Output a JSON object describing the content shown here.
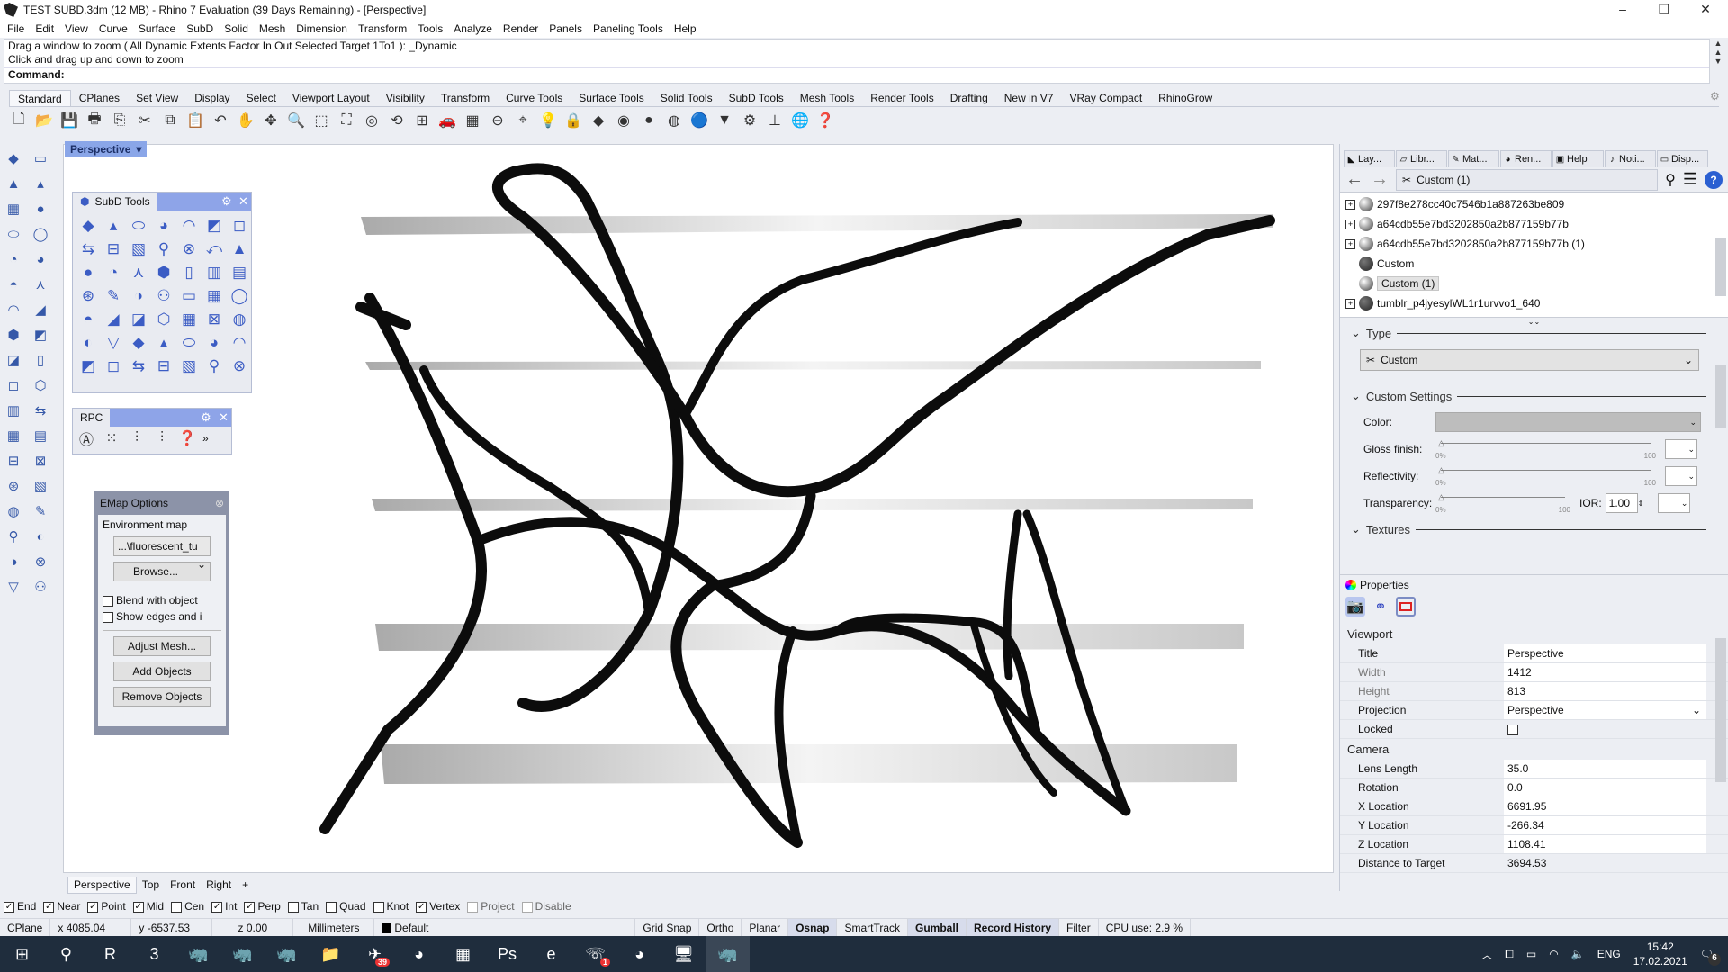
{
  "window": {
    "title": "TEST SUBD.3dm (12 MB) - Rhino 7 Evaluation (39 Days Remaining) - [Perspective]",
    "minimize": "–",
    "restore": "❐",
    "close": "✕"
  },
  "menu": [
    "File",
    "Edit",
    "View",
    "Curve",
    "Surface",
    "SubD",
    "Solid",
    "Mesh",
    "Dimension",
    "Transform",
    "Tools",
    "Analyze",
    "Render",
    "Panels",
    "Paneling Tools",
    "Help"
  ],
  "command": {
    "line1": "Drag a window to zoom ( All  Dynamic  Extents  Factor  In  Out  Selected  Target  1To1 ): _Dynamic",
    "line2": "Click and drag up and down to zoom",
    "prompt": "Command:"
  },
  "toolbar_tabs": [
    "Standard",
    "CPlanes",
    "Set View",
    "Display",
    "Select",
    "Viewport Layout",
    "Visibility",
    "Transform",
    "Curve Tools",
    "Surface Tools",
    "Solid Tools",
    "SubD Tools",
    "Mesh Tools",
    "Render Tools",
    "Drafting",
    "New in V7",
    "VRay Compact",
    "RhinoGrow"
  ],
  "toolbar_icons": [
    [
      "new-icon",
      "🗋"
    ],
    [
      "open-icon",
      "📂"
    ],
    [
      "save-icon",
      "💾"
    ],
    [
      "print-icon",
      "🖶"
    ],
    [
      "import-icon",
      "⎘"
    ],
    [
      "cut-icon",
      "✂"
    ],
    [
      "copy-icon",
      "⧉"
    ],
    [
      "paste-icon",
      "📋"
    ],
    [
      "undo-icon",
      "↶"
    ],
    [
      "pan-icon",
      "✋"
    ],
    [
      "rotate-view-icon",
      "✥"
    ],
    [
      "zoom-dynamic-icon",
      "🔍"
    ],
    [
      "zoom-window-icon",
      "⬚"
    ],
    [
      "zoom-extents-icon",
      "⛶"
    ],
    [
      "zoom-selected-icon",
      "◎"
    ],
    [
      "undo-view-icon",
      "⟲"
    ],
    [
      "four-viewports-icon",
      "⊞"
    ],
    [
      "car-icon",
      "🚗"
    ],
    [
      "grid-icon",
      "▦"
    ],
    [
      "snap-icon",
      "⊖"
    ],
    [
      "gumball-icon",
      "⌖"
    ],
    [
      "light-icon",
      "💡"
    ],
    [
      "lock-icon",
      "🔒"
    ],
    [
      "layer-icon",
      "◆"
    ],
    [
      "color-wheel-icon",
      "◉"
    ],
    [
      "shaded-icon",
      "●"
    ],
    [
      "rendered-icon",
      "◍"
    ],
    [
      "render-sphere-icon",
      "🔵"
    ],
    [
      "cone-icon",
      "▼"
    ],
    [
      "gear-settings-icon",
      "⚙"
    ],
    [
      "dimension-icon",
      "⊥"
    ],
    [
      "globe-icon",
      "🌐"
    ],
    [
      "help-icon",
      "❓"
    ]
  ],
  "viewport": {
    "active_label": "Perspective",
    "bottom_tabs": [
      "Perspective",
      "Top",
      "Front",
      "Right"
    ],
    "add_tab": "+"
  },
  "left_tools": [
    "select-arrow-icon",
    "point-icon",
    "polyline-icon",
    "curve-icon",
    "circle-icon",
    "arc-icon",
    "rectangle-icon",
    "polygon-icon",
    "ellipse-icon",
    "fillet-curve-icon",
    "surface-icon",
    "surface-tools-icon",
    "box-icon",
    "boolean-icon",
    "extrude-icon",
    "solid-tools-icon",
    "mesh-icon",
    "explode-icon",
    "sphere-icon",
    "light-icon",
    "join-icon",
    "trim-icon",
    "fillet-icon",
    "offset-icon",
    "text-icon",
    "dimension-icon",
    "array-icon",
    "transform-icon",
    "block-icon",
    "analyze-icon",
    "grid-array-icon",
    "gumball-icon",
    "paint-icon",
    "check-icon",
    "cube-icon",
    "render-icon"
  ],
  "subd_panel": {
    "title": "SubD Tools",
    "icons": [
      "subd-box-icon",
      "subd-plane-icon",
      "subd-cone-icon",
      "subd-truncated-cone-icon",
      "subd-cylinder-icon",
      "subd-sphere-icon",
      "subd-ellipsoid-icon",
      "subd-torus-icon",
      "subd-quadball-icon",
      "subd-sweep1-icon",
      "subd-sweep2-icon",
      "subd-loft-icon",
      "subd-skin-icon",
      "subd-extrude-icon",
      "subd-bevel-icon",
      "subd-box-mesh-icon",
      "subd-bridge-icon",
      "subd-insert-point-icon",
      "subd-crease-icon",
      "subd-cube-icon",
      "subd-polygon-icon",
      "subd-append-icon",
      "subd-bridge-edges-icon",
      "subd-grid-icon",
      "subd-insert-edge-icon",
      "subd-delete-icon",
      "subd-slide-icon",
      "subd-fill-icon",
      "subd-patch-icon",
      "subd-offset-icon",
      "subd-thicken-icon",
      "subd-mesh-icon",
      "subd-repair-icon",
      "subd-stitch-icon",
      "subd-weld-icon",
      "subd-match-icon",
      "subd-faces-icon",
      "subd-edge-strip-icon",
      "subd-loop-icon",
      "subd-strip-icon",
      "subd-paint-icon",
      "subd-select-loop-icon",
      "subd-vertex-icon",
      "subd-face-icon",
      "subd-points-icon",
      "subd-filter-off-icon",
      "subd-filter-icon",
      "subd-symmetry-icon",
      "subd-undo-icon"
    ]
  },
  "rpc_panel": {
    "title": "RPC",
    "icons": [
      "rpc-logo-icon",
      "rpc-scatter-icon",
      "rpc-settings-icon",
      "rpc-edit-icon",
      "rpc-help-icon"
    ],
    "more": "»"
  },
  "emap": {
    "title": "EMap Options",
    "group": "Environment map",
    "map_value": "...\\fluorescent_tu",
    "browse": "Browse...",
    "blend": "Blend with object",
    "show_edges": "Show edges and i",
    "adjust": "Adjust Mesh...",
    "add": "Add Objects",
    "remove": "Remove Objects"
  },
  "right_panel": {
    "tabs": [
      "Lay...",
      "Libr...",
      "Mat...",
      "Ren...",
      "Help",
      "Noti...",
      "Disp..."
    ],
    "breadcrumb": "Custom (1)",
    "materials": [
      {
        "name": "297f8e278cc40c7546b1a887263be809",
        "expand": true
      },
      {
        "name": "a64cdb55e7bd3202850a2b877159b77b",
        "expand": true
      },
      {
        "name": "a64cdb55e7bd3202850a2b877159b77b (1)",
        "expand": true
      },
      {
        "name": "Custom",
        "expand": false
      },
      {
        "name": "Custom (1)",
        "expand": false,
        "selected": true
      },
      {
        "name": "tumblr_p4jyesylWL1r1urvvo1_640",
        "expand": true
      }
    ],
    "type_label": "Type",
    "type_value": "Custom",
    "custom_settings": "Custom Settings",
    "color_label": "Color:",
    "color_value": "#bdbdbd",
    "gloss": {
      "label": "Gloss finish:",
      "min": "0%",
      "max": "100",
      "value": 0
    },
    "reflectivity": {
      "label": "Reflectivity:",
      "min": "0%",
      "max": "100",
      "value": 0
    },
    "transparency": {
      "label": "Transparency:",
      "min": "0%",
      "max": "100",
      "value": 0
    },
    "ior_label": "IOR:",
    "ior_value": "1.00",
    "textures": "Textures"
  },
  "properties": {
    "title": "Properties",
    "viewport_header": "Viewport",
    "viewport_rows": [
      [
        "Title",
        "Perspective"
      ],
      [
        "Width",
        "1412"
      ],
      [
        "Height",
        "813"
      ],
      [
        "Projection",
        "Perspective"
      ],
      [
        "Locked",
        ""
      ]
    ],
    "camera_header": "Camera",
    "camera_rows": [
      [
        "Lens Length",
        "35.0"
      ],
      [
        "Rotation",
        "0.0"
      ],
      [
        "X Location",
        "6691.95"
      ],
      [
        "Y Location",
        "-266.34"
      ],
      [
        "Z Location",
        "1108.41"
      ],
      [
        "Distance to Target",
        "3694.53"
      ]
    ]
  },
  "osnap": [
    {
      "label": "End",
      "checked": true
    },
    {
      "label": "Near",
      "checked": true
    },
    {
      "label": "Point",
      "checked": true
    },
    {
      "label": "Mid",
      "checked": true
    },
    {
      "label": "Cen",
      "checked": false
    },
    {
      "label": "Int",
      "checked": true
    },
    {
      "label": "Perp",
      "checked": true
    },
    {
      "label": "Tan",
      "checked": false
    },
    {
      "label": "Quad",
      "checked": false
    },
    {
      "label": "Knot",
      "checked": false
    },
    {
      "label": "Vertex",
      "checked": true
    },
    {
      "label": "Project",
      "checked": false,
      "disabled": true
    },
    {
      "label": "Disable",
      "checked": false,
      "disabled": true
    }
  ],
  "status": {
    "cplane": "CPlane",
    "x": "x 4085.04",
    "y": "y -6537.53",
    "z": "z 0.00",
    "units": "Millimeters",
    "layer": "Default",
    "grid_snap": "Grid Snap",
    "ortho": "Ortho",
    "planar": "Planar",
    "osnap": "Osnap",
    "smarttrack": "SmartTrack",
    "gumball": "Gumball",
    "record_history": "Record History",
    "filter": "Filter",
    "cpu": "CPU use: 2.9 %"
  },
  "taskbar": {
    "apps": [
      [
        "start-icon",
        "⊞"
      ],
      [
        "search-icon",
        "⚲"
      ],
      [
        "revit-icon",
        "R"
      ],
      [
        "3dsmax-icon",
        "3"
      ],
      [
        "rhino-icon",
        "🦏"
      ],
      [
        "rhino6-icon",
        "🦏"
      ],
      [
        "rhino7-icon",
        "🦏"
      ],
      [
        "file-explorer-icon",
        "📁"
      ],
      [
        "telegram-icon",
        "✈"
      ],
      [
        "chrome-icon",
        "◕"
      ],
      [
        "calculator-icon",
        "▦"
      ],
      [
        "photoshop-icon",
        "Ps"
      ],
      [
        "edge-icon",
        "e"
      ],
      [
        "viber-icon",
        "☏"
      ],
      [
        "chrome2-icon",
        "◕"
      ],
      [
        "network-monitor-icon",
        "🖥"
      ],
      [
        "rhino7-active-icon",
        "🦏"
      ]
    ],
    "badges": {
      "telegram": "39",
      "viber": "1"
    },
    "lang": "ENG",
    "time": "15:42",
    "date": "17.02.2021",
    "notifications": "6"
  }
}
